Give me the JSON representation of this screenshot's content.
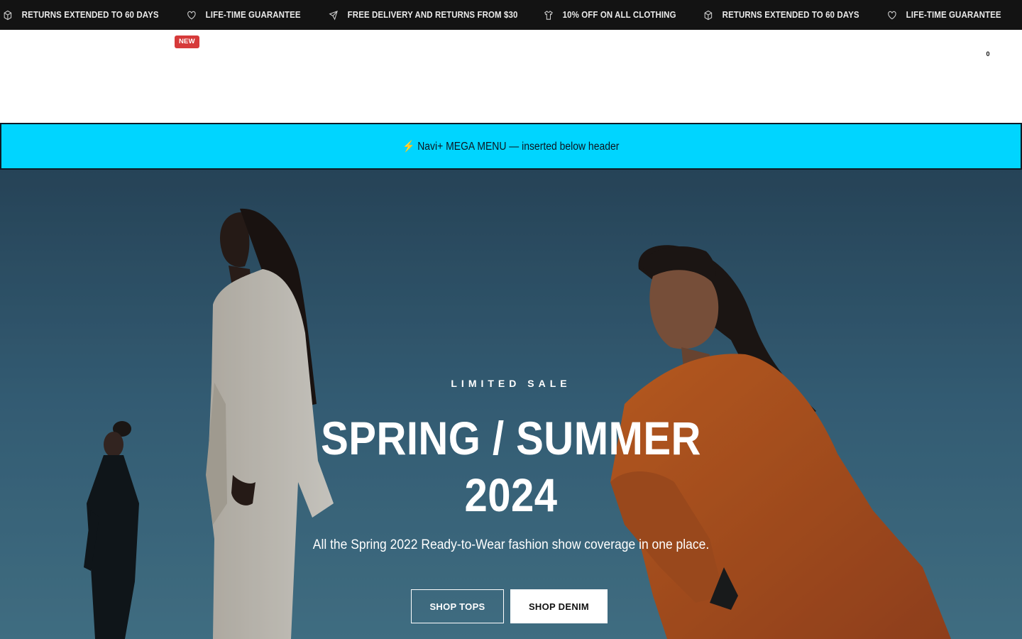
{
  "announcement": {
    "items": [
      {
        "icon": "box-icon",
        "text": "RETURNS EXTENDED TO 60 DAYS"
      },
      {
        "icon": "heart-icon",
        "text": "LIFE-TIME GUARANTEE"
      },
      {
        "icon": "plane-icon",
        "text": "FREE DELIVERY AND RETURNS FROM $30"
      },
      {
        "icon": "shirt-icon",
        "text": "10% OFF ON ALL CLOTHING"
      },
      {
        "icon": "box-icon",
        "text": "RETURNS EXTENDED TO 60 DAYS"
      },
      {
        "icon": "heart-icon",
        "text": "LIFE-TIME GUARANTEE"
      }
    ]
  },
  "header": {
    "new_badge": "NEW",
    "cart_count": "0"
  },
  "mega_menu": {
    "text": "⚡ Navi+ MEGA MENU — inserted below header"
  },
  "hero": {
    "eyebrow": "LIMITED SALE",
    "headline_line1": "SPRING / SUMMER",
    "headline_line2": "2024",
    "subline": "All the Spring 2022 Ready-to-Wear fashion show coverage in one place.",
    "button_tops": "SHOP TOPS",
    "button_denim": "SHOP DENIM"
  },
  "colors": {
    "announcement_bg": "#131313",
    "mega_bg": "#00d5ff",
    "badge_red": "#d63a3a",
    "sky": "#3c6d89",
    "orange_suit": "#c65a1e"
  }
}
